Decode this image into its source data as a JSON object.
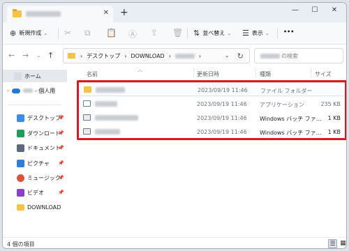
{
  "titlebar": {
    "tab_close": "✕",
    "new_tab": "+",
    "minimize": "—",
    "maximize": "☐",
    "close": "✕"
  },
  "toolbar": {
    "new_label": "新規作成",
    "sort_label": "並べ替え",
    "view_label": "表示",
    "more_label": "•••"
  },
  "address": {
    "crumbs": [
      "デスクトップ",
      "DOWNLOAD"
    ],
    "search_suffix": "の検索"
  },
  "sidebar": {
    "home": "ホーム",
    "onedrive_suffix": "- 個人用",
    "items": [
      {
        "label": "デスクトップ",
        "color": "#3a8ee6"
      },
      {
        "label": "ダウンロード",
        "color": "#1e9e5a"
      },
      {
        "label": "ドキュメント",
        "color": "#5b6b7c"
      },
      {
        "label": "ピクチャ",
        "color": "#2f7fd8"
      },
      {
        "label": "ミュージック",
        "color": "#e0503a"
      },
      {
        "label": "ビデオ",
        "color": "#8b3fd0"
      },
      {
        "label": "DOWNLOAD",
        "color": "#f5c242"
      }
    ]
  },
  "columns": {
    "name": "名前",
    "date": "更新日時",
    "type": "種類",
    "size": "サイズ"
  },
  "files": [
    {
      "date": "2023/09/19 11:46",
      "type": "ファイル フォルダー",
      "size": "",
      "icon": "folder-icon"
    },
    {
      "date": "2023/09/19 11:46",
      "type": "アプリケーション",
      "size": "235 KB",
      "icon": "application-icon"
    },
    {
      "date": "2023/09/19 11:46",
      "type": "Windows バッチ ファ...",
      "size": "1 KB",
      "icon": "batch-file-icon"
    },
    {
      "date": "2023/09/19 11:46",
      "type": "Windows バッチ ファ...",
      "size": "1 KB",
      "icon": "batch-file-icon"
    }
  ],
  "status": {
    "item_count": "4 個の項目"
  }
}
